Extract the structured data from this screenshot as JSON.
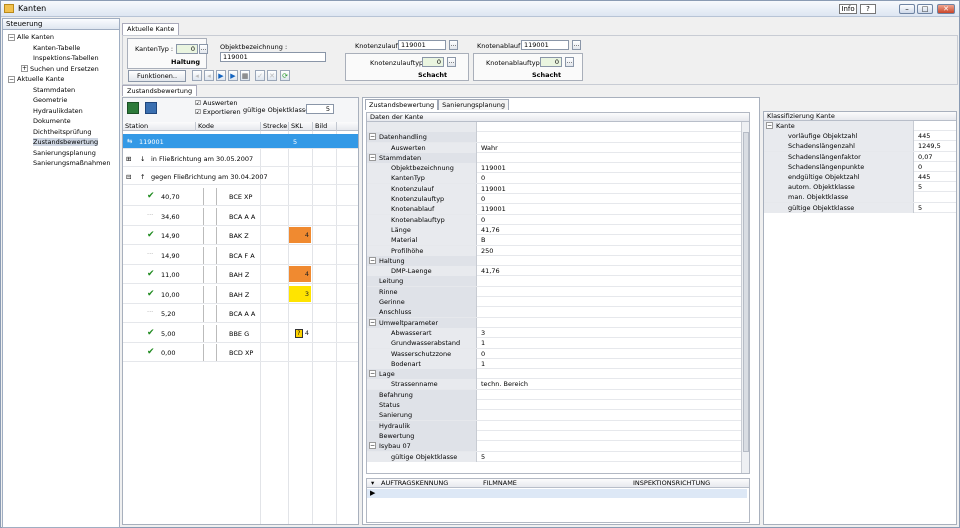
{
  "window": {
    "title": "Kanten",
    "info": "Info",
    "help": "?",
    "min": "–",
    "max": "□",
    "close": "✕"
  },
  "sidebar": {
    "header": "Steuerung",
    "items": [
      {
        "label": "Alle Kanten",
        "toggle": "−",
        "level": 0
      },
      {
        "label": "Kanten-Tabelle",
        "level": 1
      },
      {
        "label": "Inspektions-Tabellen",
        "level": 1
      },
      {
        "label": "Suchen und Ersetzen",
        "toggle": "+",
        "level": 1
      },
      {
        "label": "Aktuelle Kante",
        "toggle": "−",
        "level": 0
      },
      {
        "label": "Stammdaten",
        "level": 1
      },
      {
        "label": "Geometrie",
        "level": 1
      },
      {
        "label": "Hydraulikdaten",
        "level": 1
      },
      {
        "label": "Dokumente",
        "level": 1
      },
      {
        "label": "Dichtheitsprüfung",
        "level": 1
      },
      {
        "label": "Zustandsbewertung",
        "level": 1,
        "selected": true
      },
      {
        "label": "Sanierungsplanung",
        "level": 1
      },
      {
        "label": "Sanierungsmaßnahmen",
        "level": 1
      }
    ]
  },
  "main": {
    "tab": "Aktuelle Kante",
    "subtab": "Zustandsbewertung"
  },
  "header": {
    "kantentyp_label": "KantenTyp :",
    "kantentyp_value": "0",
    "kantentyp_text": "Haltung",
    "objektbez_label": "Objektbezeichnung :",
    "objektbez_value": "119001",
    "kz_label": "Knotenzulauf :",
    "kz_value": "119001",
    "kzt_label": "Knotenzulauftyp :",
    "kzt_value": "0",
    "kzt_text": "Schacht",
    "ka_label": "Knotenablauf :",
    "ka_value": "119001",
    "kat_label": "Knotenablauftyp :",
    "kat_value": "0",
    "kat_text": "Schacht",
    "funktionen": "Funktionen..",
    "dots": "..."
  },
  "inspection": {
    "auswerten": "Auswerten",
    "exportieren": "Exportieren",
    "gok_label": "gültige Objektklasse :",
    "gok_value": "5",
    "cols": [
      "Station",
      "Kode",
      "Strecke",
      "SKL",
      "Bild"
    ],
    "main_row": {
      "label": "119001",
      "skl": "5"
    },
    "group1": "in Fließrichtung am 30.05.2007",
    "group2": "gegen Fließrichtung am 30.04.2007",
    "rows": [
      {
        "station": "40,70",
        "kode": "BCE XP",
        "skl": "",
        "check": true
      },
      {
        "station": "34,60",
        "kode": "BCA A A",
        "skl": "",
        "check": false
      },
      {
        "station": "14,90",
        "kode": "BAK Z",
        "skl": "4",
        "check": true,
        "color": "or"
      },
      {
        "station": "14,90",
        "kode": "BCA F A",
        "skl": "",
        "check": false
      },
      {
        "station": "11,00",
        "kode": "BAH Z",
        "skl": "4",
        "check": true,
        "color": "or"
      },
      {
        "station": "10,00",
        "kode": "BAH Z",
        "skl": "3",
        "check": true,
        "color": "ye"
      },
      {
        "station": "5,20",
        "kode": "BCA A A",
        "skl": "",
        "check": false
      },
      {
        "station": "5,00",
        "kode": "BBE G",
        "skl": "4",
        "check": true,
        "q": "?"
      },
      {
        "station": "0,00",
        "kode": "BCD XP",
        "skl": "",
        "check": true
      }
    ]
  },
  "middle": {
    "tabs": [
      "Zustandsbewertung",
      "Sanierungsplanung"
    ],
    "grid_header": "Daten der Kante",
    "rows": [
      {
        "k": "",
        "v": "",
        "level": 0
      },
      {
        "k": "Datenhandling",
        "v": "",
        "level": 0,
        "cat": true,
        "toggle": "−"
      },
      {
        "k": "Auswerten",
        "v": "Wahr",
        "level": 1
      },
      {
        "k": "Stammdaten",
        "v": "",
        "level": 0,
        "cat": true,
        "toggle": "−"
      },
      {
        "k": "Objektbezeichnung",
        "v": "119001",
        "level": 1
      },
      {
        "k": "KantenTyp",
        "v": "0",
        "level": 1
      },
      {
        "k": "Knotenzulauf",
        "v": "119001",
        "level": 1
      },
      {
        "k": "Knotenzulauftyp",
        "v": "0",
        "level": 1
      },
      {
        "k": "Knotenablauf",
        "v": "119001",
        "level": 1
      },
      {
        "k": "Knotenablauftyp",
        "v": "0",
        "level": 1
      },
      {
        "k": "Länge",
        "v": "41,76",
        "level": 1
      },
      {
        "k": "Material",
        "v": "B",
        "level": 1
      },
      {
        "k": "Profilhöhe",
        "v": "250",
        "level": 1
      },
      {
        "k": "Haltung",
        "v": "",
        "level": 0,
        "cat": true,
        "toggle": "−"
      },
      {
        "k": "DMP-Laenge",
        "v": "41,76",
        "level": 1
      },
      {
        "k": "Leitung",
        "v": "",
        "level": 0,
        "cat": true
      },
      {
        "k": "Rinne",
        "v": "",
        "level": 0,
        "cat": true
      },
      {
        "k": "Gerinne",
        "v": "",
        "level": 0,
        "cat": true
      },
      {
        "k": "Anschluss",
        "v": "",
        "level": 0,
        "cat": true
      },
      {
        "k": "Umweltparameter",
        "v": "",
        "level": 0,
        "cat": true,
        "toggle": "−"
      },
      {
        "k": "Abwasserart",
        "v": "3",
        "level": 1
      },
      {
        "k": "Grundwasserabstand",
        "v": "1",
        "level": 1
      },
      {
        "k": "Wasserschutzzone",
        "v": "0",
        "level": 1
      },
      {
        "k": "Bodenart",
        "v": "1",
        "level": 1
      },
      {
        "k": "Lage",
        "v": "",
        "level": 0,
        "cat": true,
        "toggle": "−"
      },
      {
        "k": "Strassenname",
        "v": "techn. Bereich",
        "level": 1
      },
      {
        "k": "Befahrung",
        "v": "",
        "level": 0,
        "cat": true
      },
      {
        "k": "Status",
        "v": "",
        "level": 0,
        "cat": true
      },
      {
        "k": "Sanierung",
        "v": "",
        "level": 0,
        "cat": true
      },
      {
        "k": "Hydraulik",
        "v": "",
        "level": 0,
        "cat": true
      },
      {
        "k": "Bewertung",
        "v": "",
        "level": 0,
        "cat": true
      },
      {
        "k": "Isybau 07",
        "v": "",
        "level": 0,
        "cat": true,
        "toggle": "−"
      },
      {
        "k": "gültige Objektklasse",
        "v": "5",
        "level": 1
      }
    ],
    "lower_cols": [
      "AUFTRAGSKENNUNG",
      "FILMNAME",
      "INSPEKTIONSRICHTUNG"
    ]
  },
  "right": {
    "header": "Klassifizierung Kante",
    "rows": [
      {
        "k": "Kante",
        "v": "",
        "cat": true,
        "toggle": "−"
      },
      {
        "k": "vorläufige Objektzahl",
        "v": "445"
      },
      {
        "k": "Schadenslängenzahl",
        "v": "1249,5"
      },
      {
        "k": "Schadenslängenfaktor",
        "v": "0,07"
      },
      {
        "k": "Schadenslängenpunkte",
        "v": "0"
      },
      {
        "k": "endgültige Objektzahl",
        "v": "445"
      },
      {
        "k": "autom. Objektklasse",
        "v": "5"
      },
      {
        "k": "man. Objektklasse",
        "v": ""
      },
      {
        "k": "gültige Objektklasse",
        "v": "5"
      }
    ]
  }
}
